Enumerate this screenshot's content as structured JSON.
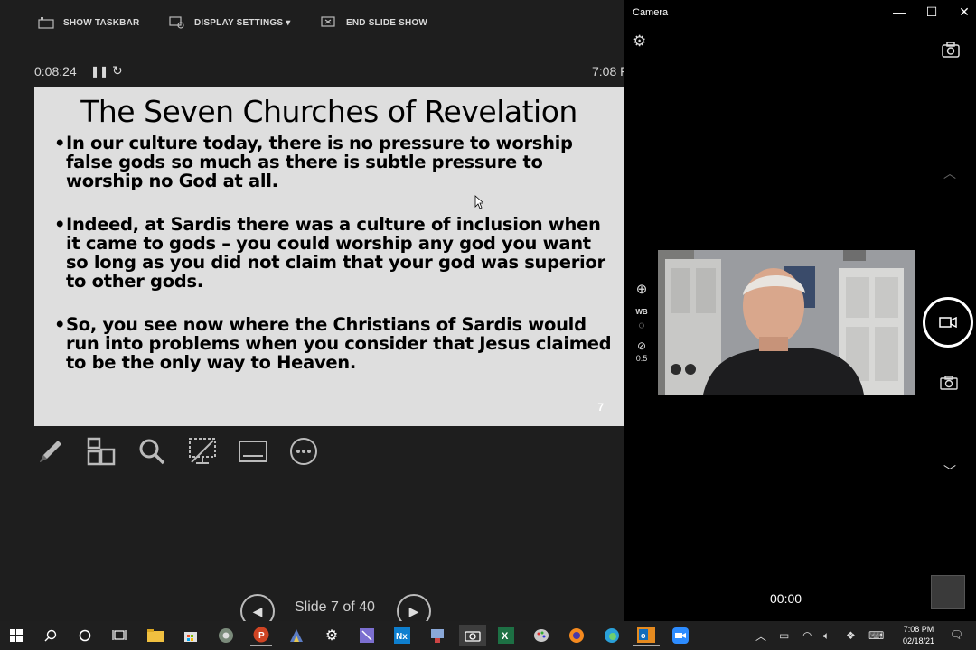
{
  "presenter": {
    "toolbar": {
      "show_taskbar": "SHOW TASKBAR",
      "display_settings": "DISPLAY SETTINGS ▾",
      "end_slide_show": "END SLIDE SHOW"
    },
    "timer": "0:08:24",
    "clock": "7:08 F",
    "slide": {
      "title": "The Seven Churches of Revelation",
      "bullets": [
        "In our culture today, there is no pressure to worship false gods so much as there is subtle pressure to worship no God at all.",
        "Indeed, at Sardis there was a culture of inclusion when it came to gods – you could worship any god you want so long as you did not claim that your god was superior to other gods.",
        "So, you see now where the Christians of Sardis would run into problems when you consider that Jesus claimed to be the only way to Heaven."
      ],
      "number": "7"
    },
    "slide_counter": "Slide 7 of 40"
  },
  "camera": {
    "title": "Camera",
    "wb_label": "WB",
    "exposure_value": "0.5",
    "record_time": "00:00"
  },
  "taskbar": {
    "time": "7:08 PM",
    "date": "02/18/21"
  },
  "colors": {
    "presenter_bg": "#1e1e1e",
    "slide_bg": "#dedede",
    "camera_bg": "#000000",
    "taskbar_bg": "#1f1f1f"
  }
}
